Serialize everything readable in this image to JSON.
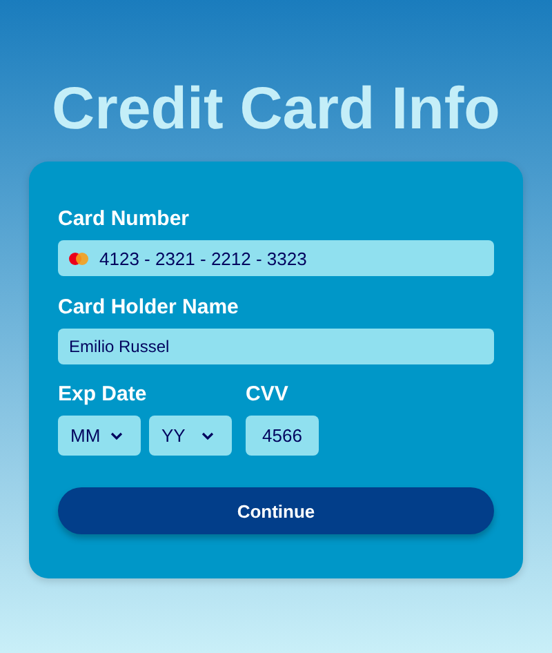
{
  "title": "Credit Card Info",
  "card_number": {
    "label": "Card Number",
    "value": "4123 - 2321 - 2212 - 3323"
  },
  "card_holder": {
    "label": "Card Holder Name",
    "value": "Emilio Russel"
  },
  "exp_date": {
    "label": "Exp Date",
    "selects": [
      {
        "value": "MM"
      },
      {
        "value": "YY"
      }
    ]
  },
  "cvv": {
    "label": "CVV",
    "value": "4566"
  },
  "button": {
    "label": "Continue"
  }
}
